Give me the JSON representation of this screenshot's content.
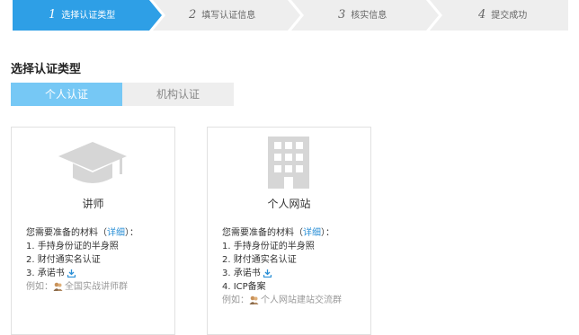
{
  "steps": [
    {
      "num": "1",
      "label": "选择认证类型",
      "active": true
    },
    {
      "num": "2",
      "label": "填写认证信息",
      "active": false
    },
    {
      "num": "3",
      "label": "核实信息",
      "active": false
    },
    {
      "num": "4",
      "label": "提交成功",
      "active": false
    }
  ],
  "section_title": "选择认证类型",
  "tabs": [
    {
      "label": "个人认证",
      "active": true
    },
    {
      "label": "机构认证",
      "active": false
    }
  ],
  "cards": [
    {
      "name": "讲师",
      "icon": "graduation-cap-icon",
      "requirements_prefix": "您需要准备的材料（",
      "detail_link": "详细",
      "requirements_suffix": "）：",
      "items": [
        "1. 手持身份证的半身照",
        "2. 财付通实名认证",
        "3. 承诺书"
      ],
      "example_prefix": "例如：",
      "example_text": "全国实战讲师群"
    },
    {
      "name": "个人网站",
      "icon": "building-icon",
      "requirements_prefix": "您需要准备的材料（",
      "detail_link": "详细",
      "requirements_suffix": "）：",
      "items": [
        "1. 手持身份证的半身照",
        "2. 财付通实名认证",
        "3. 承诺书",
        "4. ICP备案"
      ],
      "example_prefix": "例如：",
      "example_text": "个人网站建站交流群"
    }
  ],
  "colors": {
    "step_active": "#2e9fe6",
    "step_inactive": "#eeeeee",
    "tab_active": "#76c8f5",
    "link": "#2a8fd6"
  }
}
